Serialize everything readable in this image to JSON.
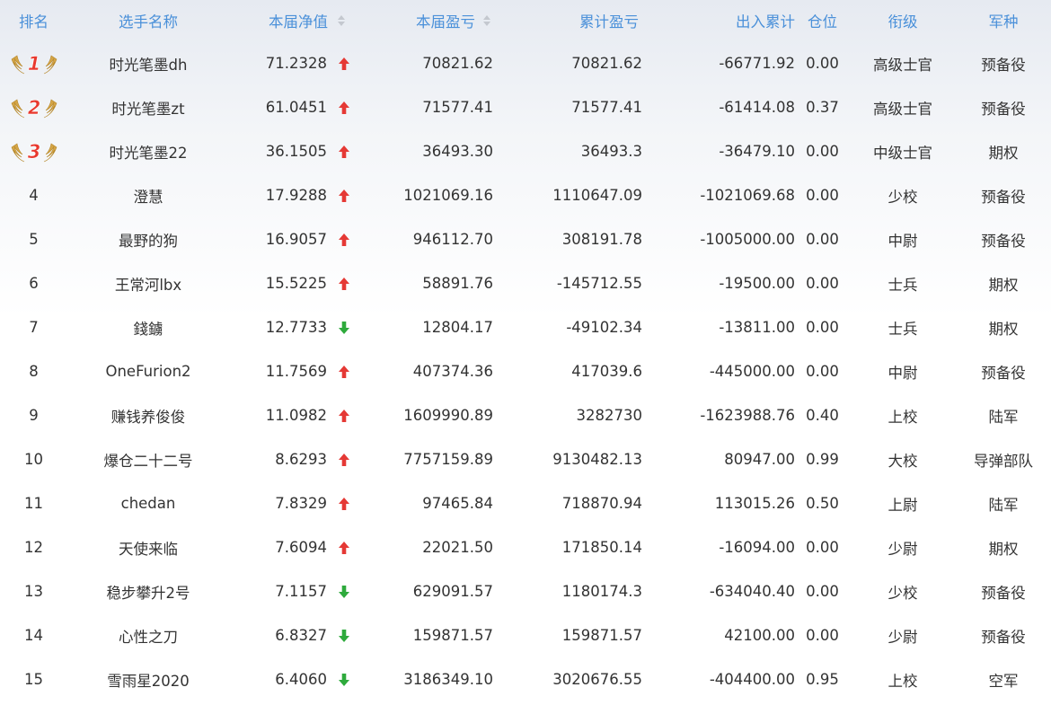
{
  "header": {
    "rank": "排名",
    "name": "选手名称",
    "nav": "本届净值",
    "current_pl": "本届盈亏",
    "cumulative_pl": "累计盈亏",
    "in_out": "出入累计",
    "position": "仓位",
    "title": "衔级",
    "army": "军种"
  },
  "colors": {
    "header_text": "#4a90d9",
    "up": "#e53935",
    "down": "#2eaa3c",
    "medal": "#d4a547",
    "medal_number": "#e8382e"
  },
  "rows": [
    {
      "rank": "1",
      "medal": true,
      "name": "时光笔墨dh",
      "nav": "71.2328",
      "trend": "up",
      "current_pl": "70821.62",
      "cumulative_pl": "70821.62",
      "in_out": "-66771.92",
      "position": "0.00",
      "title": "高级士官",
      "army": "预备役"
    },
    {
      "rank": "2",
      "medal": true,
      "name": "时光笔墨zt",
      "nav": "61.0451",
      "trend": "up",
      "current_pl": "71577.41",
      "cumulative_pl": "71577.41",
      "in_out": "-61414.08",
      "position": "0.37",
      "title": "高级士官",
      "army": "预备役"
    },
    {
      "rank": "3",
      "medal": true,
      "name": "时光笔墨22",
      "nav": "36.1505",
      "trend": "up",
      "current_pl": "36493.30",
      "cumulative_pl": "36493.3",
      "in_out": "-36479.10",
      "position": "0.00",
      "title": "中级士官",
      "army": "期权"
    },
    {
      "rank": "4",
      "medal": false,
      "name": "澄慧",
      "nav": "17.9288",
      "trend": "up",
      "current_pl": "1021069.16",
      "cumulative_pl": "1110647.09",
      "in_out": "-1021069.68",
      "position": "0.00",
      "title": "少校",
      "army": "预备役"
    },
    {
      "rank": "5",
      "medal": false,
      "name": "最野的狗",
      "nav": "16.9057",
      "trend": "up",
      "current_pl": "946112.70",
      "cumulative_pl": "308191.78",
      "in_out": "-1005000.00",
      "position": "0.00",
      "title": "中尉",
      "army": "预备役"
    },
    {
      "rank": "6",
      "medal": false,
      "name": "王常河lbx",
      "nav": "15.5225",
      "trend": "up",
      "current_pl": "58891.76",
      "cumulative_pl": "-145712.55",
      "in_out": "-19500.00",
      "position": "0.00",
      "title": "士兵",
      "army": "期权"
    },
    {
      "rank": "7",
      "medal": false,
      "name": "錢鐪",
      "nav": "12.7733",
      "trend": "down",
      "current_pl": "12804.17",
      "cumulative_pl": "-49102.34",
      "in_out": "-13811.00",
      "position": "0.00",
      "title": "士兵",
      "army": "期权"
    },
    {
      "rank": "8",
      "medal": false,
      "name": "OneFurion2",
      "nav": "11.7569",
      "trend": "up",
      "current_pl": "407374.36",
      "cumulative_pl": "417039.6",
      "in_out": "-445000.00",
      "position": "0.00",
      "title": "中尉",
      "army": "预备役"
    },
    {
      "rank": "9",
      "medal": false,
      "name": "赚钱养俊俊",
      "nav": "11.0982",
      "trend": "up",
      "current_pl": "1609990.89",
      "cumulative_pl": "3282730",
      "in_out": "-1623988.76",
      "position": "0.40",
      "title": "上校",
      "army": "陆军"
    },
    {
      "rank": "10",
      "medal": false,
      "name": "爆仓二十二号",
      "nav": "8.6293",
      "trend": "up",
      "current_pl": "7757159.89",
      "cumulative_pl": "9130482.13",
      "in_out": "80947.00",
      "position": "0.99",
      "title": "大校",
      "army": "导弹部队"
    },
    {
      "rank": "11",
      "medal": false,
      "name": "chedan",
      "nav": "7.8329",
      "trend": "up",
      "current_pl": "97465.84",
      "cumulative_pl": "718870.94",
      "in_out": "113015.26",
      "position": "0.50",
      "title": "上尉",
      "army": "陆军"
    },
    {
      "rank": "12",
      "medal": false,
      "name": "天使来临",
      "nav": "7.6094",
      "trend": "up",
      "current_pl": "22021.50",
      "cumulative_pl": "171850.14",
      "in_out": "-16094.00",
      "position": "0.00",
      "title": "少尉",
      "army": "期权"
    },
    {
      "rank": "13",
      "medal": false,
      "name": "稳步攀升2号",
      "nav": "7.1157",
      "trend": "down",
      "current_pl": "629091.57",
      "cumulative_pl": "1180174.3",
      "in_out": "-634040.40",
      "position": "0.00",
      "title": "少校",
      "army": "预备役"
    },
    {
      "rank": "14",
      "medal": false,
      "name": "心性之刀",
      "nav": "6.8327",
      "trend": "down",
      "current_pl": "159871.57",
      "cumulative_pl": "159871.57",
      "in_out": "42100.00",
      "position": "0.00",
      "title": "少尉",
      "army": "预备役"
    },
    {
      "rank": "15",
      "medal": false,
      "name": "雪雨星2020",
      "nav": "6.4060",
      "trend": "down",
      "current_pl": "3186349.10",
      "cumulative_pl": "3020676.55",
      "in_out": "-404400.00",
      "position": "0.95",
      "title": "上校",
      "army": "空军"
    }
  ]
}
